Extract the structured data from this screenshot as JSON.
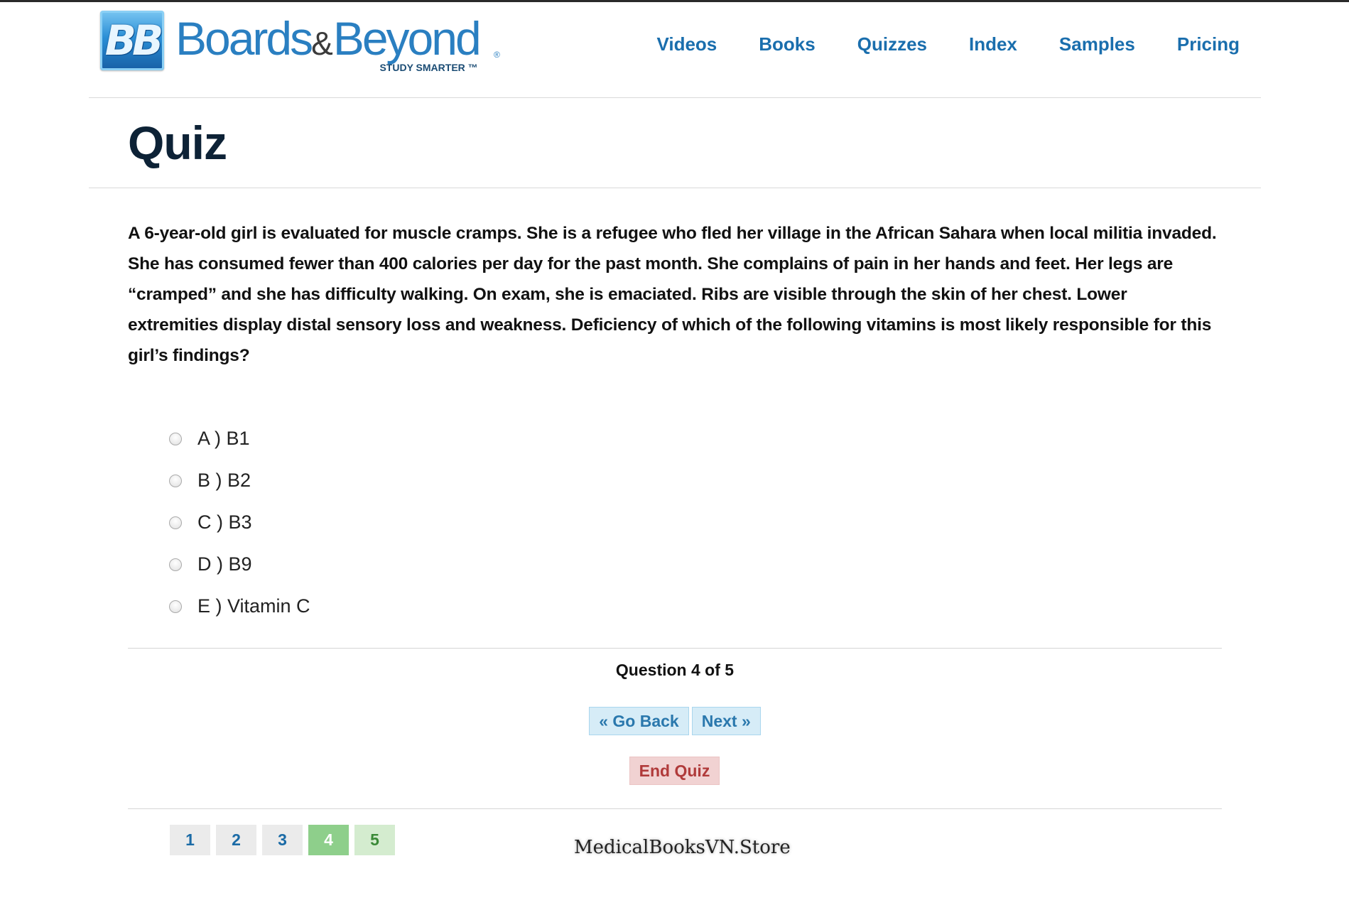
{
  "brand": {
    "logo_mark": "BB",
    "name_part1": "Boards",
    "name_amp": "&",
    "name_part2": "Beyond",
    "registered": "®",
    "tagline": "STUDY SMARTER ™"
  },
  "nav": {
    "items": [
      "Videos",
      "Books",
      "Quizzes",
      "Index",
      "Samples",
      "Pricing"
    ]
  },
  "page": {
    "title": "Quiz"
  },
  "question": {
    "text": "A 6-year-old girl is evaluated for muscle cramps. She is a refugee who fled her village in the African Sahara when local militia invaded. She has consumed fewer than 400 calories per day for the past month. She complains of pain in her hands and feet. Her legs are “cramped” and she has difficulty walking. On exam, she is emaciated. Ribs are visible through the skin of her chest. Lower extremities display distal sensory loss and weakness. Deficiency of which of the following vitamins is most likely responsible for this girl’s findings?",
    "options": [
      "A ) B1",
      "B ) B2",
      "C ) B3",
      "D ) B9",
      "E ) Vitamin C"
    ],
    "selected": null
  },
  "progress": {
    "counter": "Question 4 of 5",
    "current": 4,
    "total": 5
  },
  "buttons": {
    "back": "« Go Back",
    "next": "Next »",
    "end": "End Quiz"
  },
  "pager": {
    "pages": [
      "1",
      "2",
      "3",
      "4",
      "5"
    ]
  },
  "watermark": "MedicalBooksVN.Store",
  "colors": {
    "brand_blue": "#2a7fc1",
    "nav_blue": "#1a6ead",
    "title_navy": "#0d2236",
    "current_page_green": "#8ecf8b",
    "end_red": "#b03a3a"
  }
}
